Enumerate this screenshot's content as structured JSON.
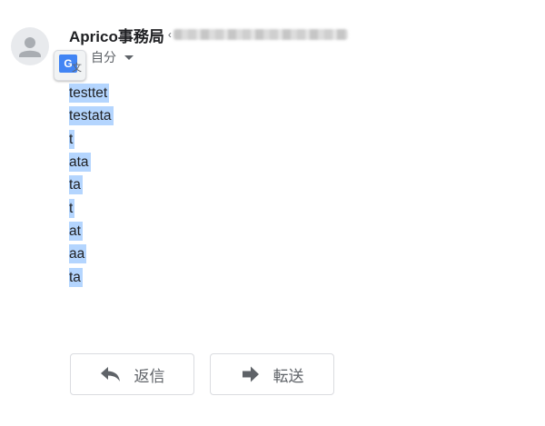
{
  "message": {
    "sender_name": "Aprico事務局",
    "sender_separator": "‹",
    "recipient_label": "自分",
    "body_lines": [
      "testtet",
      "testata",
      "t",
      "ata",
      "ta",
      "t",
      "at",
      "aa",
      "ta"
    ]
  },
  "translate_badge": {
    "g_letter": "G",
    "wen_glyph": "文"
  },
  "actions": {
    "reply_label": "返信",
    "forward_label": "転送"
  },
  "icons": {
    "avatar": "person-icon",
    "recipient_menu": "caret-down-icon",
    "translate": "google-translate-icon",
    "reply": "reply-arrow-icon",
    "forward": "forward-arrow-icon"
  },
  "colors": {
    "selection_highlight": "#b4d5fe",
    "translate_blue": "#4285f4",
    "icon_gray": "#5f6368",
    "button_border": "#dadce0"
  }
}
